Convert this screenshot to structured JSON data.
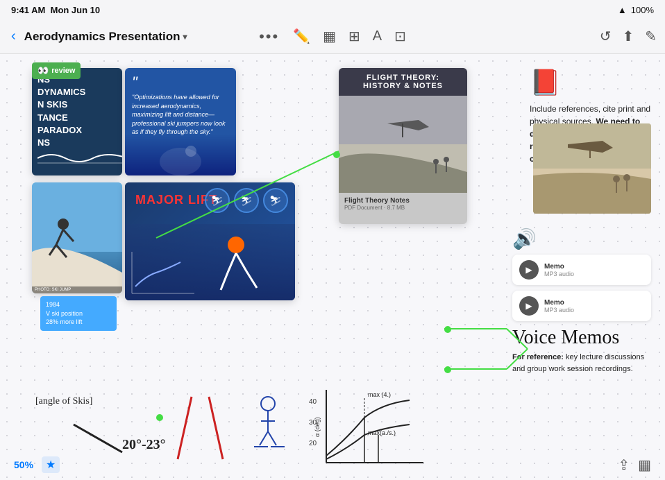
{
  "statusBar": {
    "time": "9:41 AM",
    "date": "Mon Jun 10",
    "wifi": "WiFi",
    "battery": "100%"
  },
  "toolbar": {
    "backLabel": "‹",
    "title": "Aerodynamics Presentation",
    "chevron": "▾",
    "dots": "•••"
  },
  "reviewLabel": {
    "text": "review",
    "eyes": "👀"
  },
  "card1": {
    "lines": [
      "NS",
      "DYNAMICS",
      "N SKIS",
      "TANCE",
      "PARADOX",
      "NS"
    ]
  },
  "card2": {
    "quote": "\"Optimizations have allowed for increased aerodynamics, maximizing lift and distance—professional ski jumpers now look as if they fly through the sky.\""
  },
  "cardFlight": {
    "title": "FLIGHT THEORY:\nHISTORY & NOTES",
    "filename": "Flight Theory Notes",
    "filetype": "PDF Document · 8.7 MB"
  },
  "refBox": {
    "icon": "📕",
    "text": "Include references, cite print and physical sources.",
    "boldText": "We need to demonstrate how we researched theory and concepts."
  },
  "card4": {
    "title": "MAJOR LIFT",
    "infoBox": {
      "year": "1984",
      "position": "V ski position",
      "lift": "28% more lift"
    }
  },
  "voiceMemos": {
    "speakerIcon": "🔊",
    "title": "Voice Memos",
    "memo1": {
      "title": "Memo",
      "type": "MP3 audio"
    },
    "memo2": {
      "title": "Memo",
      "type": "MP3 audio"
    },
    "description": "For reference: key lecture discussions and group work session recordings.",
    "descBold": "For reference:"
  },
  "handwriting": {
    "angleLabel": "[angle of Skis]",
    "angle": "20°-23°"
  },
  "bottomBar": {
    "zoom": "50%",
    "starLabel": "★"
  }
}
